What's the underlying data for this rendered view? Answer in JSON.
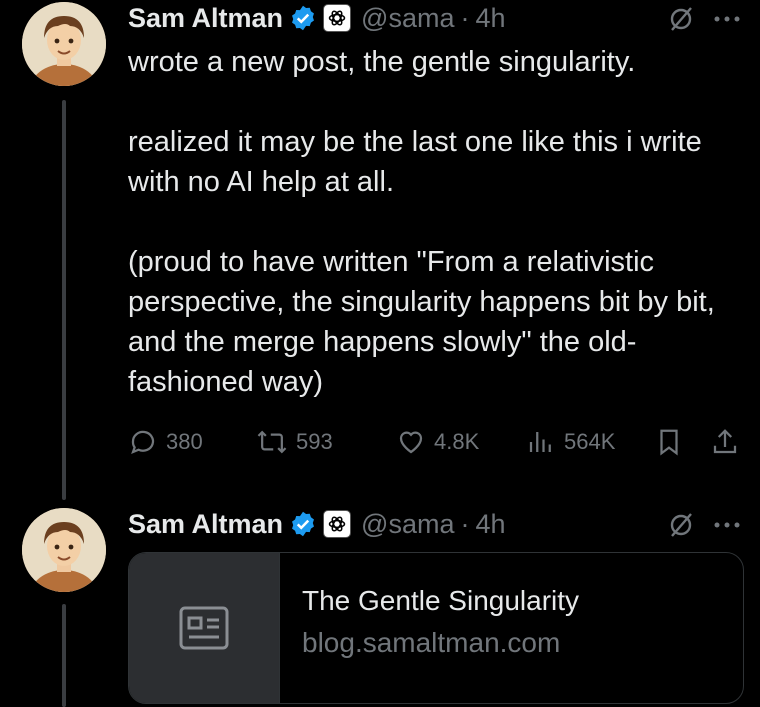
{
  "tweets": [
    {
      "author": {
        "name": "Sam Altman",
        "handle": "@sama",
        "avatar": "person-avatar"
      },
      "separator": "·",
      "time": "4h",
      "body": [
        "wrote a new post, the gentle singularity.",
        "realized it may be the last one like this i write with no AI help at all.",
        "(proud to have written \"From a relativistic perspective, the singularity happens bit by bit, and the merge happens slowly\" the old-fashioned way)"
      ],
      "actions": {
        "replies": "380",
        "reposts": "593",
        "likes": "4.8K",
        "views": "564K"
      }
    },
    {
      "author": {
        "name": "Sam Altman",
        "handle": "@sama",
        "avatar": "person-avatar"
      },
      "separator": "·",
      "time": "4h",
      "link_card": {
        "title": "The Gentle Singularity",
        "domain": "blog.samaltman.com",
        "icon": "article-icon"
      }
    }
  ],
  "colors": {
    "background": "#000000",
    "text": "#e7e9ea",
    "muted": "#71767b",
    "verified": "#1d9bf0",
    "thread_line": "#3a3d41"
  }
}
